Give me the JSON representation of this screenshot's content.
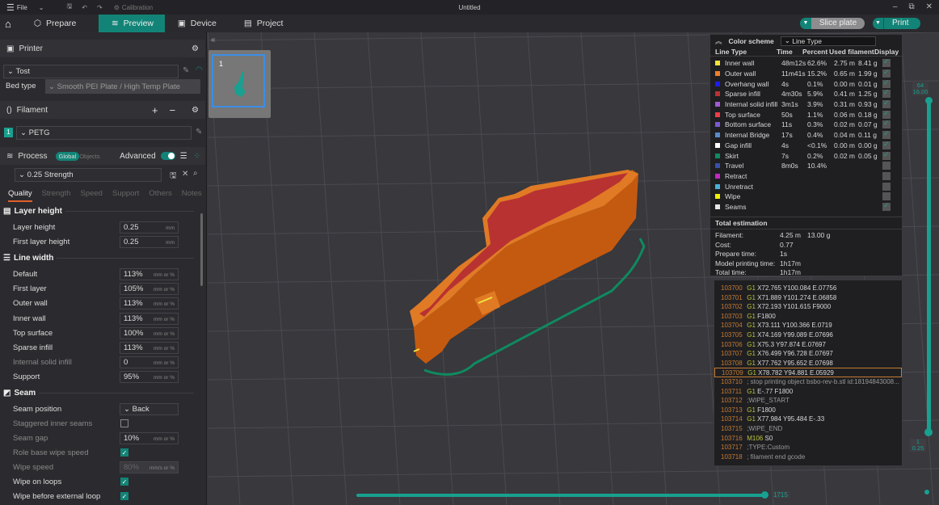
{
  "titlebar": {
    "file": "File",
    "calibration": "Calibration",
    "title": "Untitled"
  },
  "tabs": [
    {
      "label": "Prepare"
    },
    {
      "label": "Preview"
    },
    {
      "label": "Device"
    },
    {
      "label": "Project"
    }
  ],
  "actions": {
    "slice": "Slice plate",
    "print": "Print"
  },
  "sidebar": {
    "printer": {
      "title": "Printer",
      "preset": "Tost",
      "bed_type_label": "Bed type",
      "bed_type": "Smooth PEI Plate / High Temp Plate"
    },
    "filament": {
      "title": "Filament",
      "index": "1",
      "preset": "PETG"
    },
    "process": {
      "title": "Process",
      "global": "Global",
      "objects": "Objects",
      "advanced": "Advanced",
      "advanced_on": true,
      "preset": "0.25 Strength"
    },
    "subtabs": [
      "Quality",
      "Strength",
      "Speed",
      "Support",
      "Others",
      "Notes"
    ],
    "groups": {
      "layer_height": "Layer height",
      "line_width": "Line width",
      "seam": "Seam"
    },
    "layer_height": [
      {
        "label": "Layer height",
        "value": "0.25",
        "unit": "mm"
      },
      {
        "label": "First layer height",
        "value": "0.25",
        "unit": "mm"
      }
    ],
    "line_width": [
      {
        "label": "Default",
        "value": "113%",
        "unit": "mm or %"
      },
      {
        "label": "First layer",
        "value": "105%",
        "unit": "mm or %"
      },
      {
        "label": "Outer wall",
        "value": "113%",
        "unit": "mm or %"
      },
      {
        "label": "Inner wall",
        "value": "113%",
        "unit": "mm or %"
      },
      {
        "label": "Top surface",
        "value": "100%",
        "unit": "mm or %"
      },
      {
        "label": "Sparse infill",
        "value": "113%",
        "unit": "mm or %"
      },
      {
        "label": "Internal solid infill",
        "value": "0",
        "unit": "mm or %",
        "dim": true
      },
      {
        "label": "Support",
        "value": "95%",
        "unit": "mm or %"
      }
    ],
    "seam": {
      "position_label": "Seam position",
      "position": "Back",
      "staggered_label": "Staggered inner seams",
      "staggered": false,
      "gap_label": "Seam gap",
      "gap": "10%",
      "gap_unit": "mm or %",
      "role_wipe_label": "Role base wipe speed",
      "role_wipe": true,
      "wipe_speed_label": "Wipe speed",
      "wipe_speed": "80%",
      "wipe_speed_unit": "mm/s or %",
      "wipe_loops_label": "Wipe on loops",
      "wipe_loops": true,
      "wipe_ext_label": "Wipe before external loop",
      "wipe_ext": true
    }
  },
  "plate": {
    "number": "1"
  },
  "legend": {
    "title": "Color scheme",
    "scheme": "Line Type",
    "headers": [
      "Line Type",
      "Time",
      "Percent",
      "Used filament",
      "Display"
    ],
    "rows": [
      {
        "name": "Inner wall",
        "time": "48m12s",
        "pct": "62.6%",
        "len": "2.75 m",
        "wt": "8.41 g",
        "color": "#f2e23a",
        "on": true
      },
      {
        "name": "Outer wall",
        "time": "11m41s",
        "pct": "15.2%",
        "len": "0.65 m",
        "wt": "1.99 g",
        "color": "#ee7d2a",
        "on": true
      },
      {
        "name": "Overhang wall",
        "time": "4s",
        "pct": "0.1%",
        "len": "0.00 m",
        "wt": "0.01 g",
        "color": "#1c1cf0",
        "on": true
      },
      {
        "name": "Sparse infill",
        "time": "4m30s",
        "pct": "5.9%",
        "len": "0.41 m",
        "wt": "1.25 g",
        "color": "#b83232",
        "on": true
      },
      {
        "name": "Internal solid infill",
        "time": "3m1s",
        "pct": "3.9%",
        "len": "0.31 m",
        "wt": "0.93 g",
        "color": "#a25ad2",
        "on": true
      },
      {
        "name": "Top surface",
        "time": "50s",
        "pct": "1.1%",
        "len": "0.06 m",
        "wt": "0.18 g",
        "color": "#ee3c46",
        "on": true
      },
      {
        "name": "Bottom surface",
        "time": "11s",
        "pct": "0.3%",
        "len": "0.02 m",
        "wt": "0.07 g",
        "color": "#7a5ad2",
        "on": true
      },
      {
        "name": "Internal Bridge",
        "time": "17s",
        "pct": "0.4%",
        "len": "0.04 m",
        "wt": "0.11 g",
        "color": "#5a8ac8",
        "on": true
      },
      {
        "name": "Gap infill",
        "time": "4s",
        "pct": "<0.1%",
        "len": "0.00 m",
        "wt": "0.00 g",
        "color": "#ffffff",
        "on": true
      },
      {
        "name": "Skirt",
        "time": "7s",
        "pct": "0.2%",
        "len": "0.02 m",
        "wt": "0.05 g",
        "color": "#0f8a5f",
        "on": true
      },
      {
        "name": "Travel",
        "time": "8m0s",
        "pct": "10.4%",
        "len": "",
        "wt": "",
        "color": "#3850a8",
        "on": false
      },
      {
        "name": "Retract",
        "time": "",
        "pct": "",
        "len": "",
        "wt": "",
        "color": "#c428c4",
        "on": false
      },
      {
        "name": "Unretract",
        "time": "",
        "pct": "",
        "len": "",
        "wt": "",
        "color": "#48b0d8",
        "on": false
      },
      {
        "name": "Wipe",
        "time": "",
        "pct": "",
        "len": "",
        "wt": "",
        "color": "#f0f000",
        "on": false
      },
      {
        "name": "Seams",
        "time": "",
        "pct": "",
        "len": "",
        "wt": "",
        "color": "#e6e6e6",
        "on": true
      }
    ]
  },
  "estimation": {
    "title": "Total estimation",
    "rows": [
      {
        "label": "Filament:",
        "value": "4.25 m",
        "value2": "13.00 g"
      },
      {
        "label": "Cost:",
        "value": "0.77"
      },
      {
        "label": "Prepare time:",
        "value": "1s"
      },
      {
        "label": "Model printing time:",
        "value": "1h17m"
      },
      {
        "label": "Total time:",
        "value": "1h17m"
      }
    ]
  },
  "gcode": [
    {
      "n": "103700",
      "c": "G1",
      "a": "X72.765 Y100.084 E.07756"
    },
    {
      "n": "103701",
      "c": "G1",
      "a": "X71.889 Y101.274 E.06858"
    },
    {
      "n": "103702",
      "c": "G1",
      "a": "X72.193 Y101.615 F9000"
    },
    {
      "n": "103703",
      "c": "G1",
      "a": "F1800"
    },
    {
      "n": "103704",
      "c": "G1",
      "a": "X73.111 Y100.366 E.0719"
    },
    {
      "n": "103705",
      "c": "G1",
      "a": "X74.169 Y99.089 E.07696"
    },
    {
      "n": "103706",
      "c": "G1",
      "a": "X75.3 Y97.874 E.07697"
    },
    {
      "n": "103707",
      "c": "G1",
      "a": "X76.499 Y96.728 E.07697"
    },
    {
      "n": "103708",
      "c": "G1",
      "a": "X77.762 Y95.652 E.07698"
    },
    {
      "n": "103709",
      "c": "G1",
      "a": "X78.782 Y94.881 E.05929",
      "current": true
    },
    {
      "n": "103710",
      "c": "",
      "a": "; stop printing object bsbo-rev-b.stl id:18194843008..."
    },
    {
      "n": "103711",
      "c": "G1",
      "a": "E-.77 F1800"
    },
    {
      "n": "103712",
      "c": "",
      "a": ";WIPE_START"
    },
    {
      "n": "103713",
      "c": "G1",
      "a": "F1800"
    },
    {
      "n": "103714",
      "c": "G1",
      "a": "X77.984 Y95.484 E-.33"
    },
    {
      "n": "103715",
      "c": "",
      "a": ";WIPE_END"
    },
    {
      "n": "103716",
      "c": "M106",
      "a": "S0"
    },
    {
      "n": "103717",
      "c": "",
      "a": ";TYPE:Custom"
    },
    {
      "n": "103718",
      "c": "",
      "a": "; filament end gcode"
    }
  ],
  "layer_slider": {
    "top_layer": "64",
    "top_height": "16.00",
    "bottom_layer": "1",
    "bottom_height": "0.25"
  },
  "move_slider": {
    "value": "1715",
    "fraction": 1.0
  },
  "colors": {
    "accent": "#128477"
  }
}
